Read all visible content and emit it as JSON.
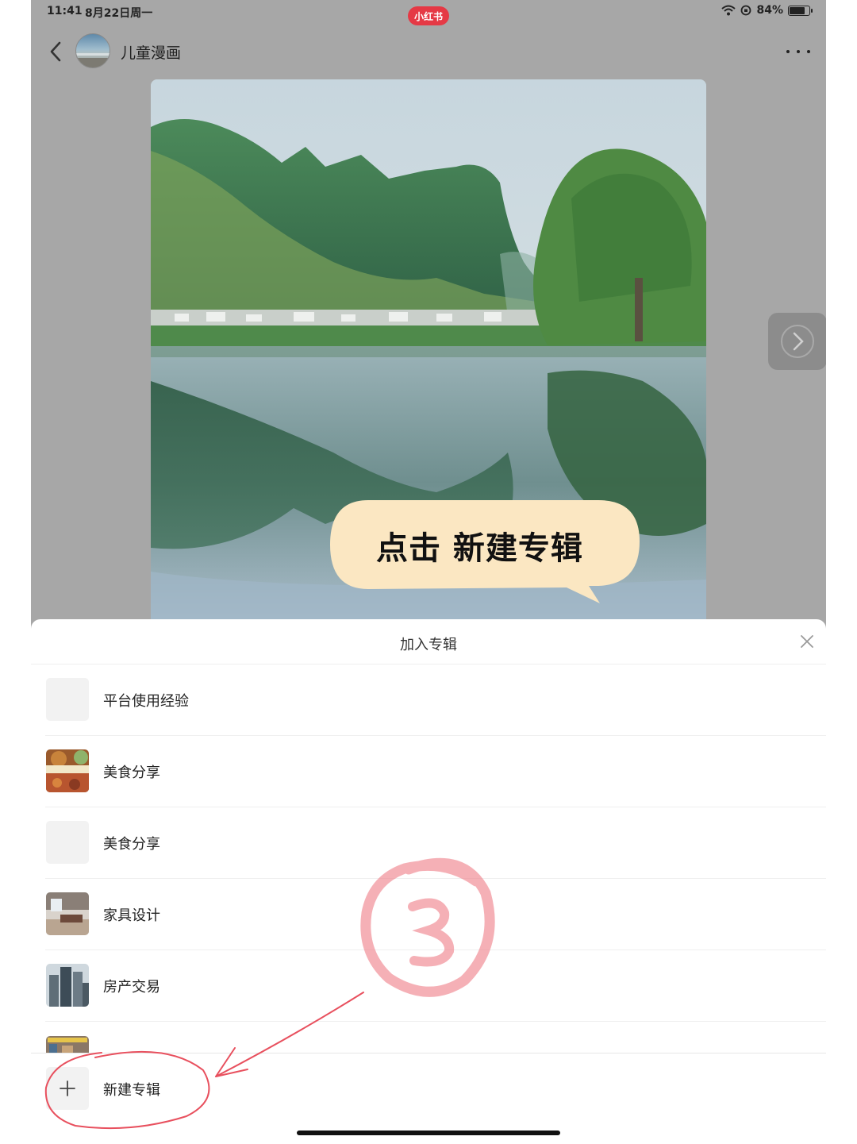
{
  "status_bar": {
    "time": "11:41",
    "date": "8月22日周一",
    "battery": "84%",
    "battery_level": 0.84
  },
  "app_badge": "小红书",
  "header": {
    "username": "儿童漫画"
  },
  "annotation": {
    "bubble_text": "点击 新建专辑",
    "step_number": "3"
  },
  "sheet": {
    "title": "加入专辑",
    "albums": [
      {
        "label": "平台使用经验",
        "thumb": "blank-thumb"
      },
      {
        "label": "美食分享",
        "thumb": "food-thumb"
      },
      {
        "label": "美食分享",
        "thumb": "blank-thumb"
      },
      {
        "label": "家具设计",
        "thumb": "room-thumb"
      },
      {
        "label": "房产交易",
        "thumb": "building-thumb"
      }
    ],
    "create_label": "新建专辑"
  },
  "colors": {
    "brand": "#e53945",
    "bubble": "#fbe7c2",
    "annotation": "#ef5b6a"
  }
}
